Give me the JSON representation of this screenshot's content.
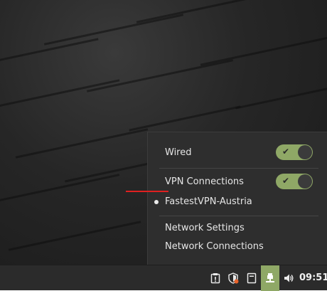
{
  "network_menu": {
    "wired_label": "Wired",
    "vpn_label": "VPN Connections",
    "vpn_entry": "FastestVPN-Austria",
    "network_settings": "Network Settings",
    "network_connections": "Network Connections",
    "wired_switch_on": true,
    "vpn_switch_on": true
  },
  "panel": {
    "clock": "09:51",
    "icons": [
      "clipboard-icon",
      "shield-update-icon",
      "notes-icon",
      "network-icon",
      "volume-icon"
    ]
  },
  "colors": {
    "switch_on": "#8fa866",
    "highlight": "#e02020",
    "menu_bg": "#2e2e2e"
  }
}
